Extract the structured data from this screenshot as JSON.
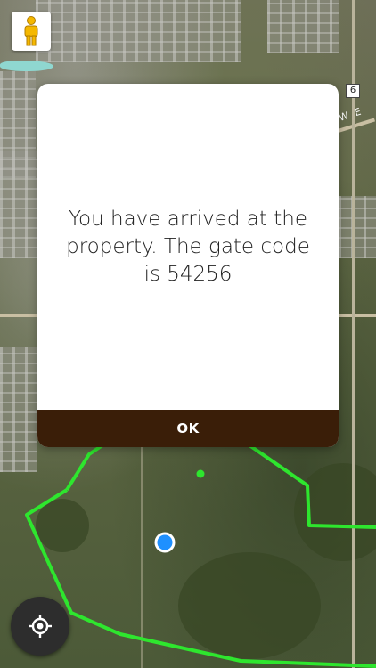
{
  "map": {
    "highway_marker": "6",
    "road_label": "W E"
  },
  "dialog": {
    "message": "You have arrived at the property. The gate code is 54256",
    "ok_label": "OK"
  },
  "controls": {
    "street_view_icon": "pegman-icon",
    "my_location_icon": "crosshair-icon"
  },
  "colors": {
    "boundary": "#2ee62e",
    "user_location": "#1e90ff",
    "ok_button_bg": "#3a1e08",
    "waypoint": "#2ee62e"
  }
}
